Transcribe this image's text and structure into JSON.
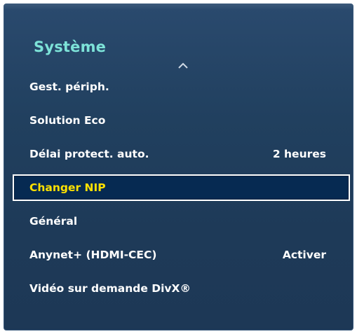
{
  "menu": {
    "title": "Système",
    "items": [
      {
        "label": "Gest. périph.",
        "value": ""
      },
      {
        "label": "Solution Eco",
        "value": ""
      },
      {
        "label": "Délai protect. auto.",
        "value": "2 heures"
      },
      {
        "label": "Changer NIP",
        "value": ""
      },
      {
        "label": "Général",
        "value": ""
      },
      {
        "label": "Anynet+ (HDMI-CEC)",
        "value": "Activer"
      },
      {
        "label": "Vidéo sur demande DivX®",
        "value": ""
      }
    ],
    "selected_index": 3
  },
  "icons": {
    "scroll_up": "chevron-up-icon"
  },
  "colors": {
    "title": "#7de3d8",
    "selected_text": "#ffe100",
    "text": "#ffffff",
    "panel": "#21405f",
    "selection_bg": "#062a52"
  }
}
